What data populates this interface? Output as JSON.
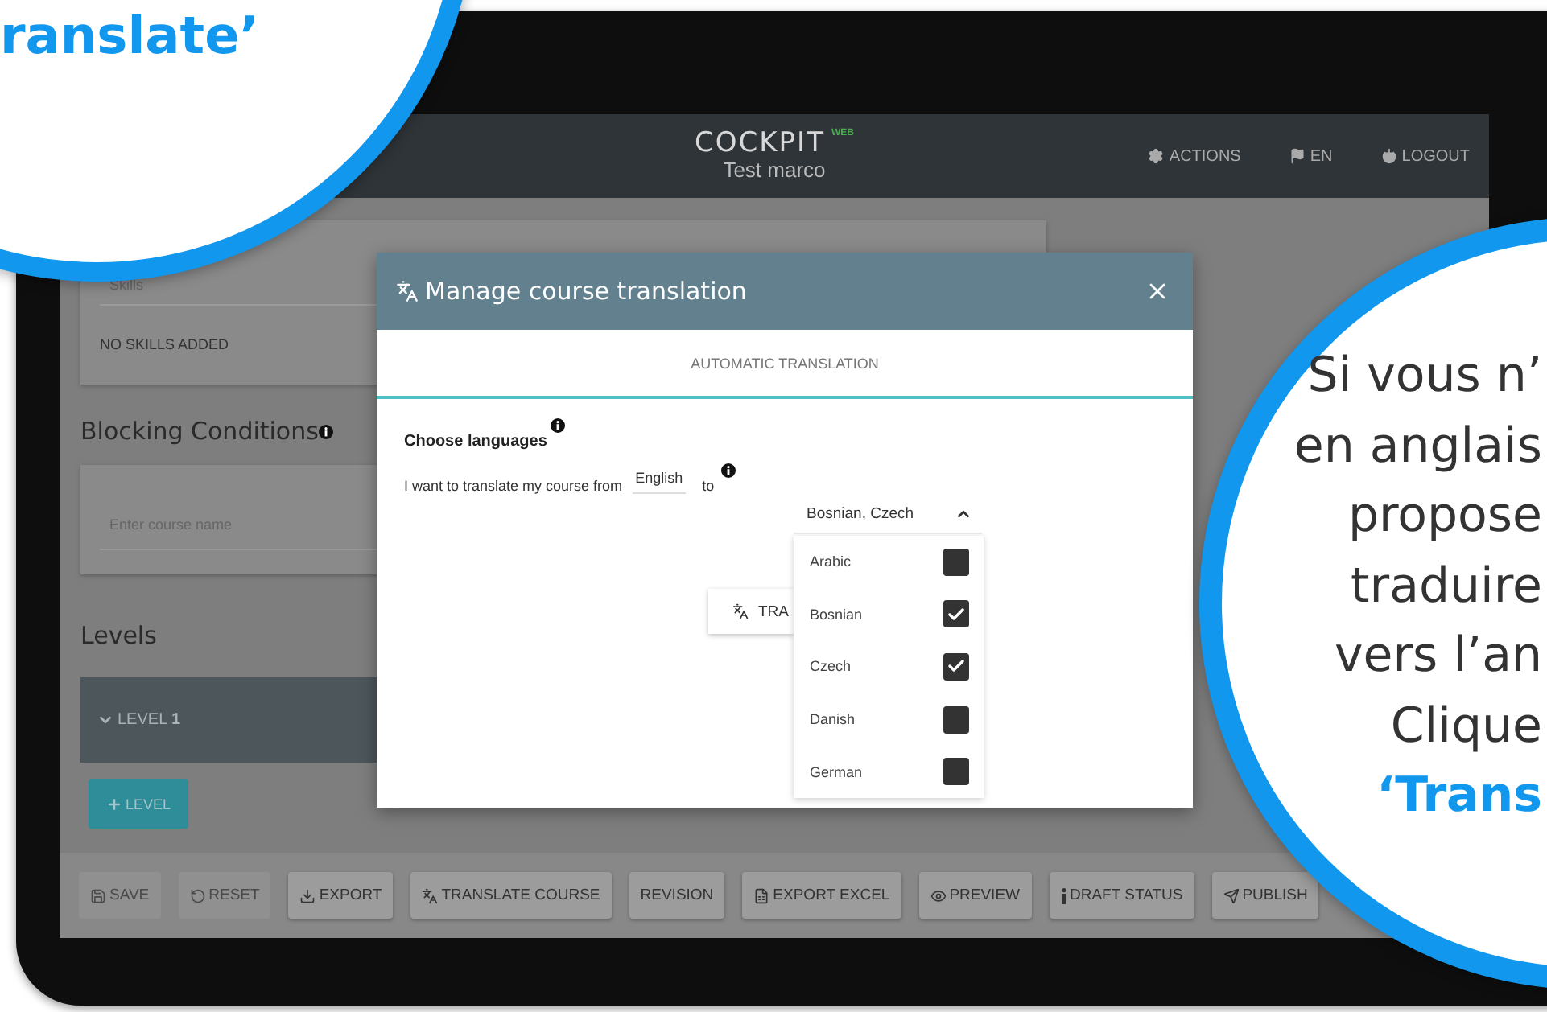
{
  "left_callout": {
    "lines": [
      {
        "text": "ranslate’",
        "highlight": true
      }
    ]
  },
  "header": {
    "logo": "COCKPIT",
    "logo_badge": "WEB",
    "subtitle": "Test marco",
    "nav": [
      {
        "label": "ACTIONS"
      },
      {
        "label": "EN"
      },
      {
        "label": "LOGOUT"
      }
    ]
  },
  "skills": {
    "placeholder": "Skills",
    "empty_text": "NO SKILLS ADDED"
  },
  "blocking_conditions": {
    "title": "Blocking Conditions",
    "placeholder": "Enter course name"
  },
  "levels": {
    "title": "Levels",
    "items": [
      {
        "label": "LEVEL **1**",
        "expanded": true
      }
    ],
    "add_button": "LEVEL"
  },
  "toolbar": [
    {
      "label": "SAVE",
      "disabled": true
    },
    {
      "label": "RESET",
      "disabled": true
    },
    {
      "label": "EXPORT",
      "disabled": false
    },
    {
      "label": "TRANSLATE COURSE",
      "disabled": false
    },
    {
      "label": "REVISION",
      "disabled": false
    },
    {
      "label": "EXPORT EXCEL",
      "disabled": false
    },
    {
      "label": "PREVIEW",
      "disabled": false
    },
    {
      "label": "DRAFT STATUS",
      "disabled": false
    },
    {
      "label": "PUBLISH",
      "disabled": false
    }
  ],
  "modal": {
    "title": "Manage course translation",
    "tabs": [
      {
        "label": "AUTOMATIC TRANSLATION",
        "selected": true
      }
    ],
    "section_title": "Choose languages",
    "sentence": "I want to translate my course from",
    "source": "English",
    "connector": "to",
    "target": "Bosnian, Czech",
    "dropdown_open": true,
    "languages": [
      {
        "name": "Arabic",
        "checked": false
      },
      {
        "name": "Bosnian",
        "checked": true
      },
      {
        "name": "Czech",
        "checked": true
      },
      {
        "name": "Danish",
        "checked": false
      },
      {
        "name": "German",
        "checked": false
      }
    ],
    "action_button": "TRA"
  },
  "right_callout": {
    "lines": [
      {
        "text": "Si vous n’",
        "highlight": false
      },
      {
        "text": "en anglais",
        "highlight": false
      },
      {
        "text": "propose",
        "highlight": false
      },
      {
        "text": "traduire",
        "highlight": false
      },
      {
        "text": "vers l’an",
        "highlight": false
      },
      {
        "text": "Clique",
        "highlight": false
      },
      {
        "text": "‘Trans",
        "highlight": true
      }
    ]
  }
}
